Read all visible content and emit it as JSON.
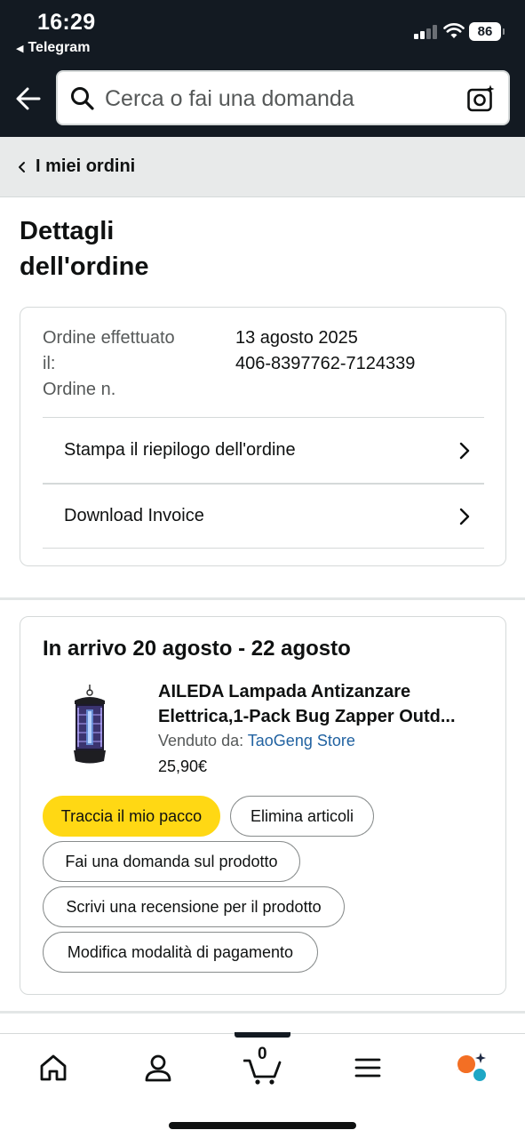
{
  "status_bar": {
    "time": "16:29",
    "back_app": "Telegram",
    "battery": "86"
  },
  "search": {
    "placeholder": "Cerca o fai una domanda"
  },
  "breadcrumb": {
    "label": "I miei ordini"
  },
  "page": {
    "title_line1": "Dettagli",
    "title_line2": "dell'ordine"
  },
  "order_info": {
    "placed_label_1": "Ordine effettuato",
    "placed_label_2": "il:",
    "number_label": "Ordine n.",
    "placed_date": "13 agosto 2025",
    "order_number": "406-8397762-7124339",
    "actions": [
      {
        "label": "Stampa il riepilogo dell'ordine"
      },
      {
        "label": "Download Invoice"
      }
    ]
  },
  "shipment": {
    "title": "In arrivo 20 agosto - 22 agosto",
    "product": {
      "title_line1": "AILEDA Lampada Antizanzare",
      "title_line2": "Elettrica,1-Pack Bug Zapper Outd...",
      "seller_label": "Venduto da:",
      "seller_name": "TaoGeng Store",
      "price": "25,90€"
    },
    "buttons": {
      "track": "Traccia il mio pacco",
      "delete": "Elimina articoli",
      "ask": "Fai una domanda sul prodotto",
      "review": "Scrivi una recensione per il prodotto",
      "payment": "Modifica modalità di pagamento"
    }
  },
  "tab_bar": {
    "cart_count": "0",
    "items": [
      "home-icon",
      "account-icon",
      "cart-icon",
      "menu-icon",
      "rufus-icon"
    ]
  },
  "colors": {
    "header_bg": "#131a22",
    "primary_button": "#ffd814",
    "link": "#2162a1",
    "accent_orange": "#f36f24",
    "accent_teal": "#1ea7c5"
  }
}
